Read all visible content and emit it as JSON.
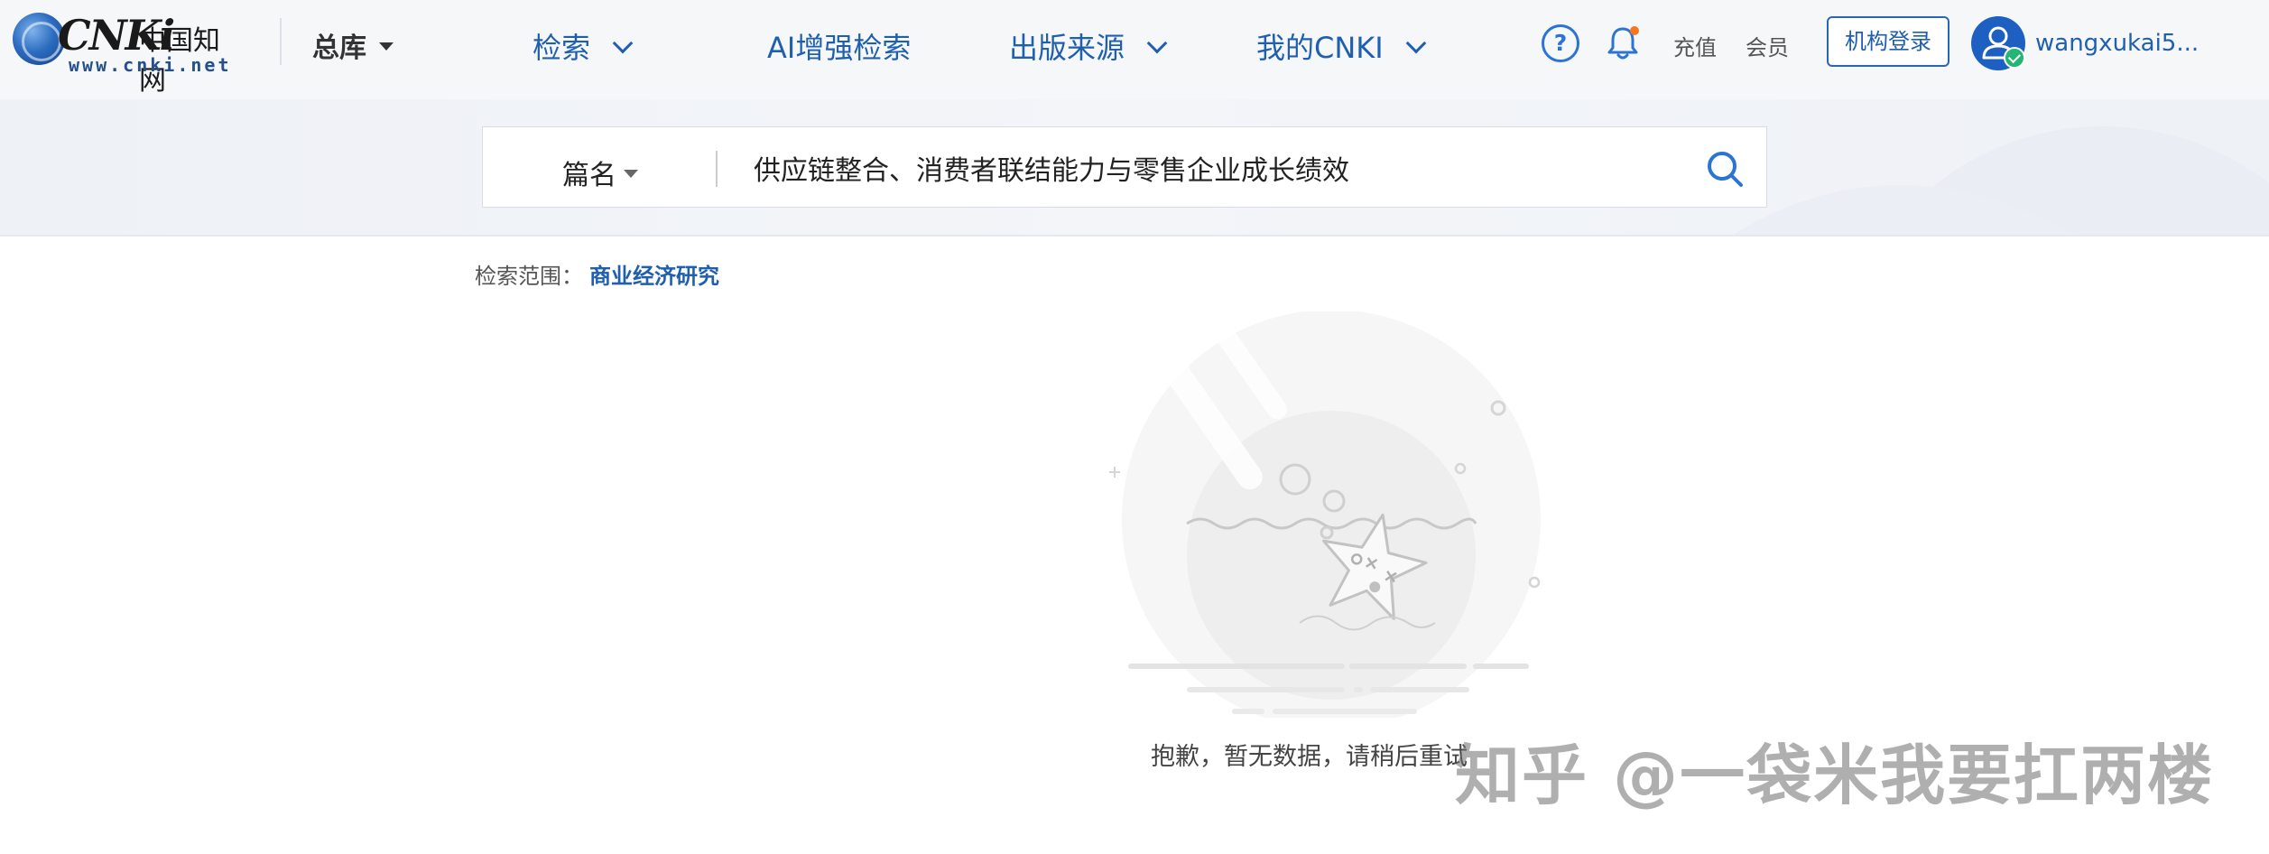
{
  "header": {
    "logo": {
      "brand": "CNKi",
      "brand_cn": "中国知网",
      "url": "www.cnki.net"
    },
    "library_selector": "总库",
    "nav": [
      {
        "label": "检索",
        "has_dropdown": true
      },
      {
        "label": "AI增强检索",
        "has_dropdown": false
      },
      {
        "label": "出版来源",
        "has_dropdown": true
      },
      {
        "label": "我的CNKI",
        "has_dropdown": true
      }
    ],
    "help_icon": "help-circle-icon",
    "notification_icon": "bell-icon",
    "recharge_label": "充值",
    "member_label": "会员",
    "org_login_label": "机构登录",
    "username": "wangxukai5..."
  },
  "search": {
    "field": "篇名",
    "query": "供应链整合、消费者联结能力与零售企业成长绩效",
    "button_icon": "search-icon"
  },
  "scope": {
    "label": "检索范围：",
    "value": "商业经济研究"
  },
  "empty_state": {
    "illustration": "starfish-bowl-illustration",
    "message": "抱歉，暂无数据，请稍后重试"
  },
  "watermark": "知乎 @一袋米我要扛两楼",
  "colors": {
    "accent": "#1f5fb0",
    "header_bg": "#f6f7f9",
    "band_bg": "#eef1f6",
    "avatar": "#1e5fc2",
    "verified": "#22b573",
    "notify_dot": "#f5781f"
  }
}
